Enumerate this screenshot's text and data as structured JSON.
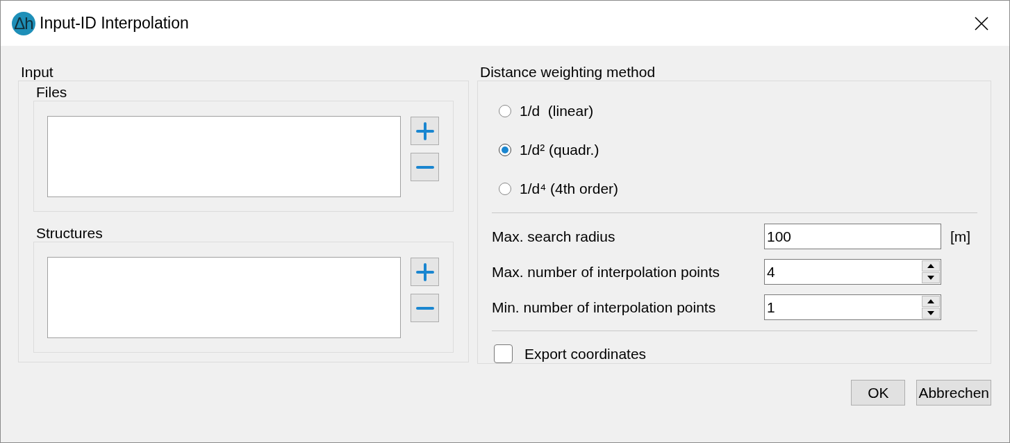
{
  "window": {
    "title": "Input-ID Interpolation",
    "logo_text": "Δh"
  },
  "input": {
    "title": "Input",
    "lists": [
      {
        "title": "Files"
      },
      {
        "title": "Structures"
      }
    ]
  },
  "distance_weighting": {
    "title": "Distance weighting method",
    "options": [
      {
        "label": "1/d  (linear)",
        "selected": false
      },
      {
        "label": "1/d² (quadr.)",
        "selected": true
      },
      {
        "label": "1/d⁴ (4th order)",
        "selected": false
      }
    ],
    "parameters": [
      {
        "kind": "text",
        "label": "Max. search radius",
        "value": "100",
        "unit": "[m]"
      },
      {
        "kind": "spin",
        "label": "Max. number of interpolation points",
        "value": "4"
      },
      {
        "kind": "spin",
        "label": "Min. number of interpolation points",
        "value": "1"
      }
    ],
    "export_coordinates": {
      "label": "Export coordinates",
      "checked": false
    }
  },
  "buttons": [
    "OK",
    "Abbrechen"
  ]
}
